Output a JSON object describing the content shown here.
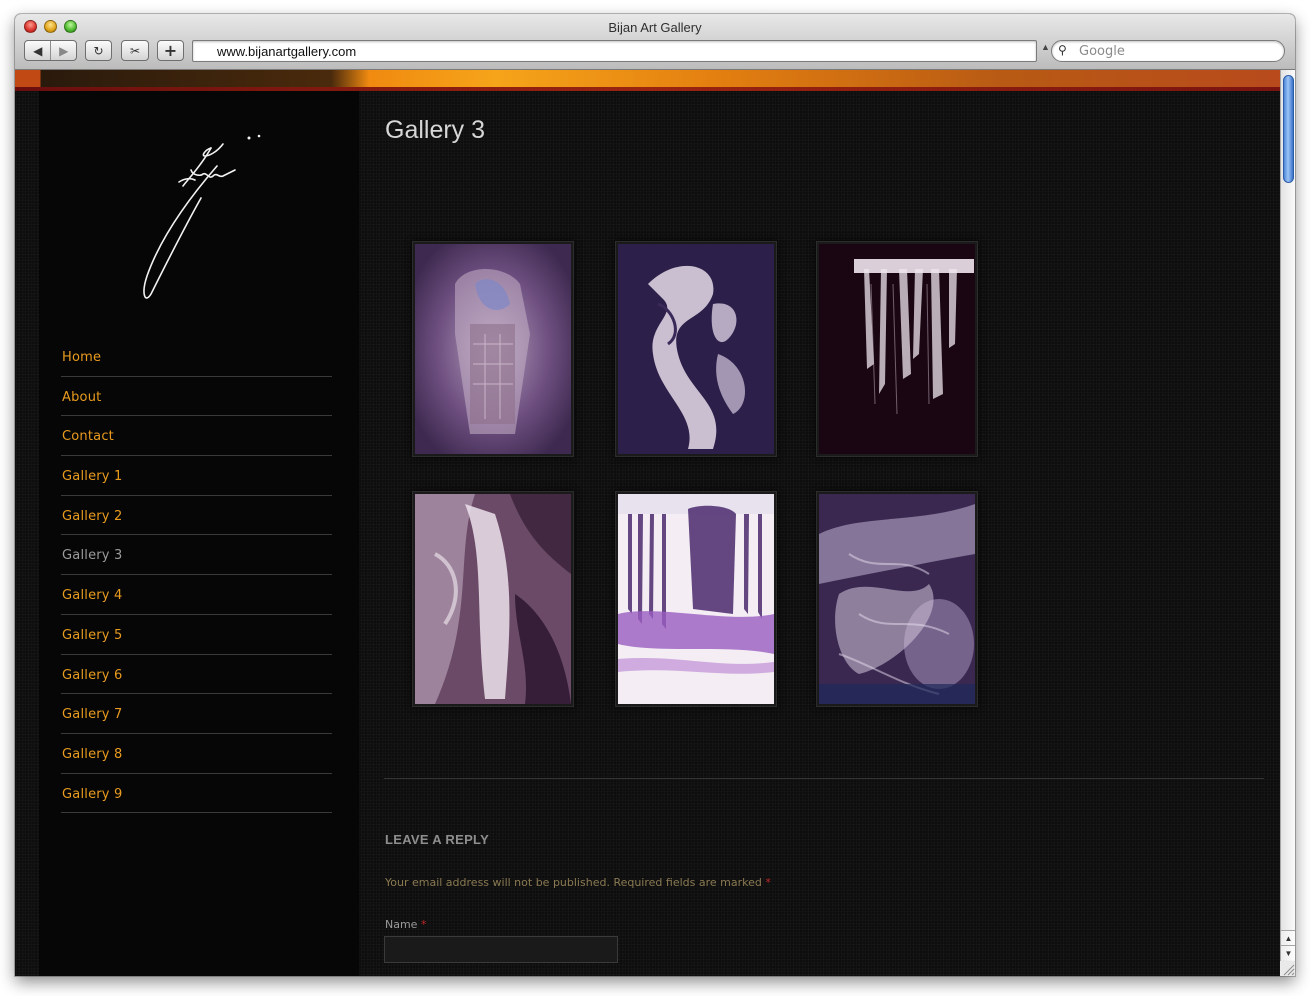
{
  "window": {
    "title": "Bijan Art Gallery"
  },
  "toolbar": {
    "back_icon": "◀",
    "forward_icon": "▶",
    "reload_icon": "↻",
    "snip_icon": "✂",
    "add_icon": "+",
    "url": "www.bijanartgallery.com",
    "search_placeholder": "Google",
    "search_icon": "⚲"
  },
  "sidebar": {
    "nav_items": [
      {
        "label": "Home"
      },
      {
        "label": "About"
      },
      {
        "label": "Contact"
      },
      {
        "label": "Gallery 1"
      },
      {
        "label": "Gallery 2"
      },
      {
        "label": "Gallery 3"
      },
      {
        "label": "Gallery 4"
      },
      {
        "label": "Gallery 5"
      },
      {
        "label": "Gallery 6"
      },
      {
        "label": "Gallery 7"
      },
      {
        "label": "Gallery 8"
      },
      {
        "label": "Gallery 9"
      }
    ],
    "current": "Gallery 3"
  },
  "main": {
    "title": "Gallery 3",
    "gallery": {
      "count": 6,
      "columns": 3
    },
    "reply": {
      "heading": "LEAVE A REPLY",
      "note": "Your email address will not be published. Required fields are marked",
      "required_mark": "*",
      "name_label": "Name",
      "name_value": ""
    }
  },
  "colors": {
    "nav_link": "#e99b1f",
    "nav_current": "#9b9b9b",
    "accent_orange": "#f6a41a",
    "required": "#c0262a"
  },
  "scroll": {
    "up_icon": "▲",
    "down_icon": "▼"
  }
}
